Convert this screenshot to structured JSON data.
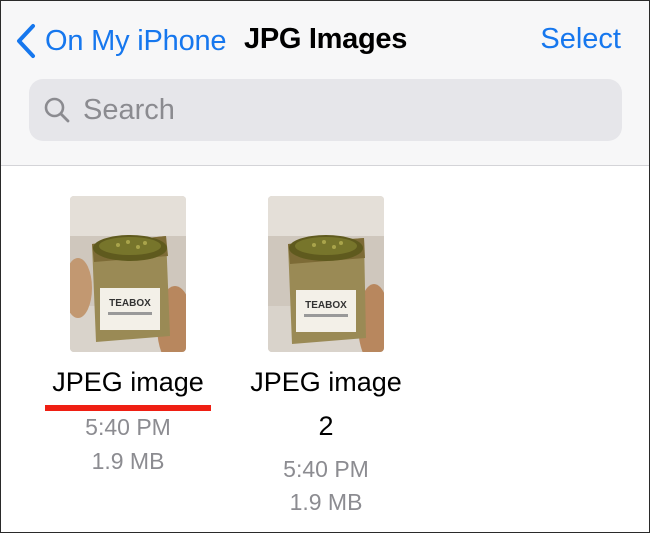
{
  "nav": {
    "back_label": "On My iPhone",
    "title": "JPG Images",
    "select_label": "Select"
  },
  "search": {
    "placeholder": "Search"
  },
  "files": [
    {
      "name": "JPEG image",
      "time": "5:40 PM",
      "size": "1.9 MB"
    },
    {
      "name_line1": "JPEG image",
      "name_line2": "2",
      "time": "5:40 PM",
      "size": "1.9 MB"
    }
  ],
  "colors": {
    "accent": "#1677ee",
    "highlight_underline": "#ef1f13",
    "secondary_text": "#8c8c91"
  },
  "icons": [
    "chevron-left-icon",
    "search-icon"
  ]
}
